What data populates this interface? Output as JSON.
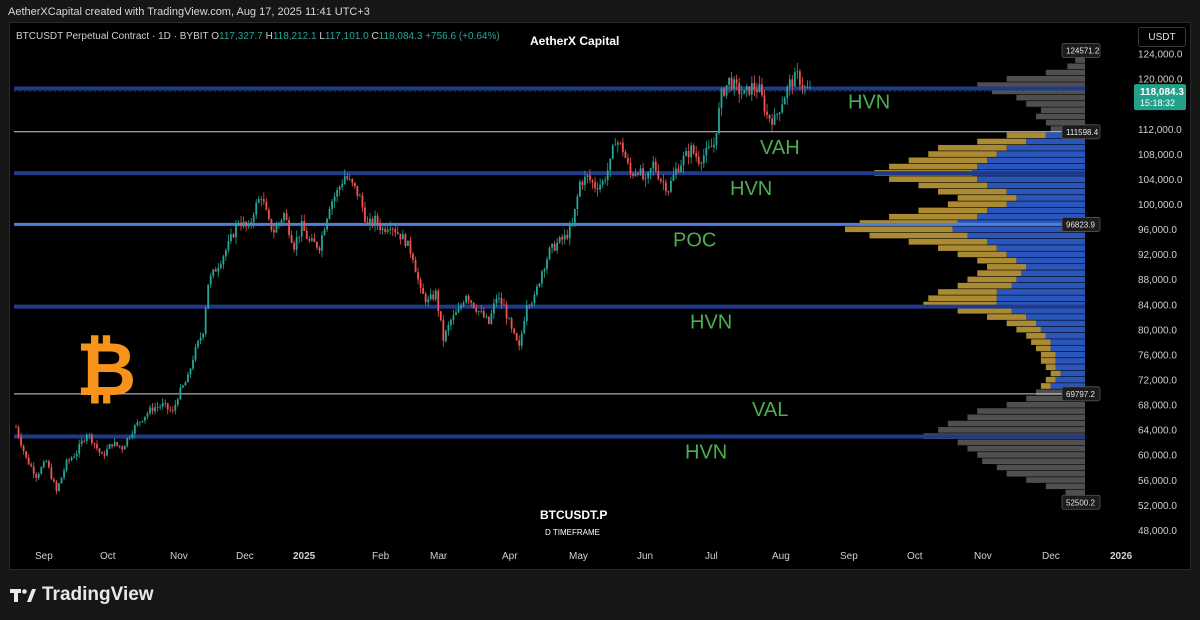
{
  "header": {
    "credit": "AetherXCapital created with TradingView.com, Aug 17, 2025 11:41 UTC+3"
  },
  "legend": {
    "symbol_text": "BTCUSDT Perpetual Contract · 1D · BYBIT",
    "open_key": "O",
    "open_val": "117,327.7",
    "high_key": "H",
    "high_val": "118,212.1",
    "low_key": "L",
    "low_val": "117,101.0",
    "close_key": "C",
    "close_val": "118,084.3",
    "change": "+756.6 (+0.64%)"
  },
  "brand": "AetherX Capital",
  "currency": "USDT",
  "watermark": {
    "symbol": "BTCUSDT.P",
    "timeframe": "D TIMEFRAME"
  },
  "footer": {
    "logo_text": "TradingView"
  },
  "colors": {
    "background": "#000000",
    "up": "#26a69a",
    "down": "#ef5350",
    "hvn_line": "#1f3a8a",
    "poc_line": "#4a7fe0",
    "value_line": "#d0d0d0",
    "annotation": "#4caf50",
    "profile_gold": "#c8a23c",
    "profile_blue": "#2f5fd0",
    "profile_gray": "#6a6a6a",
    "btc_orange": "#f7931a"
  },
  "chart_data": {
    "type": "candlestick",
    "ylim": [
      46000,
      128000
    ],
    "y_ticks": [
      "124,000.0",
      "120,000.0",
      "116,000.0",
      "112,000.0",
      "108,000.0",
      "104,000.0",
      "100,000.0",
      "96,000.0",
      "92,000.0",
      "88,000.0",
      "84,000.0",
      "80,000.0",
      "76,000.0",
      "72,000.0",
      "68,000.0",
      "64,000.0",
      "60,000.0",
      "56,000.0",
      "52,000.0",
      "48,000.0"
    ],
    "x_ticks": [
      "Sep",
      "Oct",
      "Nov",
      "Dec",
      "2025",
      "Feb",
      "Mar",
      "Apr",
      "May",
      "Jun",
      "Jul",
      "Aug",
      "Sep",
      "Oct",
      "Nov",
      "Dec",
      "2026"
    ],
    "price_labels": [
      {
        "label": "124571.2",
        "value": 124571.2
      },
      {
        "label": "111598.4",
        "value": 111598.4
      },
      {
        "label": "96823.9",
        "value": 96823.9
      },
      {
        "label": "69797.2",
        "value": 69797.2
      },
      {
        "label": "52500.2",
        "value": 52500.2
      }
    ],
    "last_price": {
      "label": "118,084.3",
      "countdown": "15:18:32",
      "value": 118084.3
    },
    "levels": [
      {
        "name": "HVN",
        "value": 118500,
        "kind": "hvn"
      },
      {
        "name": "VAH",
        "value": 111598.4,
        "kind": "value"
      },
      {
        "name": "HVN",
        "value": 105000,
        "kind": "hvn"
      },
      {
        "name": "POC",
        "value": 96823.9,
        "kind": "poc"
      },
      {
        "name": "HVN",
        "value": 83700,
        "kind": "hvn"
      },
      {
        "name": "VAL",
        "value": 69797.2,
        "kind": "value"
      },
      {
        "name": "HVN",
        "value": 63000,
        "kind": "hvn"
      }
    ],
    "closes": [
      [
        0,
        64500
      ],
      [
        4,
        59500
      ],
      [
        8,
        56800
      ],
      [
        12,
        59000
      ],
      [
        16,
        54200
      ],
      [
        20,
        58800
      ],
      [
        24,
        60500
      ],
      [
        28,
        63600
      ],
      [
        30,
        62500
      ],
      [
        34,
        59800
      ],
      [
        38,
        61900
      ],
      [
        42,
        61200
      ],
      [
        46,
        64000
      ],
      [
        50,
        66000
      ],
      [
        54,
        67500
      ],
      [
        58,
        68000
      ],
      [
        62,
        66800
      ],
      [
        64,
        69500
      ],
      [
        68,
        72300
      ],
      [
        70,
        75600
      ],
      [
        74,
        80000
      ],
      [
        76,
        87500
      ],
      [
        80,
        90500
      ],
      [
        84,
        93500
      ],
      [
        88,
        97500
      ],
      [
        92,
        96000
      ],
      [
        94,
        99000
      ],
      [
        97,
        101500
      ],
      [
        100,
        97000
      ],
      [
        102,
        95800
      ],
      [
        106,
        98500
      ],
      [
        110,
        93500
      ],
      [
        113,
        96500
      ],
      [
        116,
        94000
      ],
      [
        120,
        93400
      ],
      [
        124,
        100000
      ],
      [
        127,
        102000
      ],
      [
        130,
        104600
      ],
      [
        134,
        102500
      ],
      [
        136,
        101000
      ],
      [
        139,
        96600
      ],
      [
        142,
        97500
      ],
      [
        145,
        96000
      ],
      [
        148,
        97000
      ],
      [
        151,
        95500
      ],
      [
        154,
        94200
      ],
      [
        157,
        91800
      ],
      [
        160,
        86000
      ],
      [
        163,
        84500
      ],
      [
        166,
        85800
      ],
      [
        169,
        78500
      ],
      [
        172,
        81500
      ],
      [
        175,
        83000
      ],
      [
        178,
        85800
      ],
      [
        181,
        84000
      ],
      [
        184,
        82500
      ],
      [
        187,
        81000
      ],
      [
        190,
        85200
      ],
      [
        193,
        83700
      ],
      [
        196,
        79800
      ],
      [
        199,
        77000
      ],
      [
        202,
        84500
      ],
      [
        205,
        85000
      ],
      [
        208,
        89500
      ],
      [
        211,
        92500
      ],
      [
        214,
        93800
      ],
      [
        217,
        94700
      ],
      [
        220,
        96500
      ],
      [
        223,
        103500
      ],
      [
        226,
        104300
      ],
      [
        229,
        103000
      ],
      [
        232,
        103500
      ],
      [
        235,
        106500
      ],
      [
        237,
        110500
      ],
      [
        240,
        108800
      ],
      [
        243,
        104800
      ],
      [
        246,
        105700
      ],
      [
        249,
        103300
      ],
      [
        252,
        106500
      ],
      [
        255,
        104000
      ],
      [
        258,
        102500
      ],
      [
        261,
        105500
      ],
      [
        264,
        107300
      ],
      [
        267,
        108800
      ],
      [
        270,
        107200
      ],
      [
        273,
        108200
      ],
      [
        276,
        109600
      ],
      [
        279,
        117500
      ],
      [
        282,
        119800
      ],
      [
        285,
        118500
      ],
      [
        288,
        117500
      ],
      [
        291,
        118800
      ],
      [
        294,
        118300
      ],
      [
        297,
        114200
      ],
      [
        300,
        113500
      ],
      [
        303,
        116500
      ],
      [
        306,
        119300
      ],
      [
        309,
        120500
      ],
      [
        312,
        118500
      ],
      [
        314,
        118084
      ]
    ],
    "volume_profile": [
      [
        124000,
        8,
        8,
        0
      ],
      [
        123000,
        10,
        10,
        0
      ],
      [
        122000,
        18,
        18,
        0
      ],
      [
        121000,
        40,
        40,
        0
      ],
      [
        120000,
        80,
        80,
        0
      ],
      [
        119000,
        110,
        110,
        0
      ],
      [
        118000,
        95,
        95,
        0
      ],
      [
        117000,
        70,
        70,
        0
      ],
      [
        116000,
        60,
        60,
        0
      ],
      [
        115000,
        45,
        45,
        0
      ],
      [
        114000,
        50,
        50,
        0
      ],
      [
        113000,
        40,
        40,
        0
      ],
      [
        112000,
        35,
        35,
        0
      ],
      [
        111000,
        80,
        40,
        40
      ],
      [
        110000,
        110,
        50,
        60
      ],
      [
        109000,
        150,
        70,
        80
      ],
      [
        108000,
        160,
        70,
        90
      ],
      [
        107000,
        180,
        80,
        100
      ],
      [
        106000,
        200,
        90,
        110
      ],
      [
        105000,
        215,
        100,
        115
      ],
      [
        104000,
        200,
        90,
        110
      ],
      [
        103000,
        170,
        70,
        100
      ],
      [
        102000,
        150,
        70,
        80
      ],
      [
        101000,
        130,
        60,
        70
      ],
      [
        100000,
        140,
        60,
        80
      ],
      [
        99000,
        170,
        70,
        100
      ],
      [
        98000,
        200,
        90,
        110
      ],
      [
        97000,
        230,
        100,
        130
      ],
      [
        96000,
        245,
        110,
        135
      ],
      [
        95000,
        220,
        100,
        120
      ],
      [
        94000,
        180,
        80,
        100
      ],
      [
        93000,
        150,
        60,
        90
      ],
      [
        92000,
        130,
        50,
        80
      ],
      [
        91000,
        110,
        40,
        70
      ],
      [
        90000,
        100,
        40,
        60
      ],
      [
        89000,
        110,
        45,
        65
      ],
      [
        88000,
        120,
        50,
        70
      ],
      [
        87000,
        130,
        55,
        75
      ],
      [
        86000,
        150,
        60,
        90
      ],
      [
        85000,
        160,
        70,
        90
      ],
      [
        84000,
        165,
        75,
        90
      ],
      [
        83000,
        130,
        55,
        75
      ],
      [
        82000,
        100,
        40,
        60
      ],
      [
        81000,
        80,
        30,
        50
      ],
      [
        80000,
        70,
        25,
        45
      ],
      [
        79000,
        60,
        20,
        40
      ],
      [
        78000,
        55,
        20,
        35
      ],
      [
        77000,
        50,
        15,
        35
      ],
      [
        76000,
        45,
        15,
        30
      ],
      [
        75000,
        45,
        15,
        30
      ],
      [
        74000,
        40,
        10,
        30
      ],
      [
        73000,
        35,
        10,
        25
      ],
      [
        72000,
        40,
        10,
        30
      ],
      [
        71000,
        45,
        10,
        35
      ],
      [
        70000,
        50,
        50,
        0
      ],
      [
        69000,
        60,
        60,
        0
      ],
      [
        68000,
        80,
        80,
        0
      ],
      [
        67000,
        110,
        110,
        0
      ],
      [
        66000,
        120,
        120,
        0
      ],
      [
        65000,
        140,
        140,
        0
      ],
      [
        64000,
        150,
        150,
        0
      ],
      [
        63000,
        165,
        165,
        0
      ],
      [
        62000,
        130,
        130,
        0
      ],
      [
        61000,
        120,
        120,
        0
      ],
      [
        60000,
        110,
        110,
        0
      ],
      [
        59000,
        105,
        105,
        0
      ],
      [
        58000,
        90,
        90,
        0
      ],
      [
        57000,
        80,
        80,
        0
      ],
      [
        56000,
        60,
        60,
        0
      ],
      [
        55000,
        40,
        40,
        0
      ],
      [
        54000,
        20,
        20,
        0
      ],
      [
        53000,
        12,
        12,
        0
      ]
    ]
  }
}
